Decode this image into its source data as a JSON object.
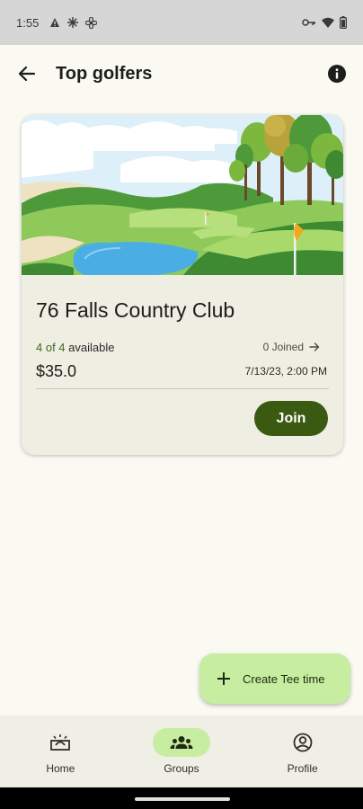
{
  "status_bar": {
    "time": "1:55"
  },
  "app_bar": {
    "title": "Top golfers"
  },
  "card": {
    "course_name": "76 Falls Country Club",
    "availability_count": "4 of 4",
    "availability_suffix": " available",
    "joined_text": "0 Joined",
    "price": "$35.0",
    "datetime": "7/13/23, 2:00 PM",
    "join_label": "Join"
  },
  "fab": {
    "label": "Create Tee time"
  },
  "bottom_nav": {
    "items": [
      {
        "label": "Home",
        "icon": "home-sunrise-icon",
        "active": false
      },
      {
        "label": "Groups",
        "icon": "groups-icon",
        "active": true
      },
      {
        "label": "Profile",
        "icon": "profile-icon",
        "active": false
      }
    ]
  },
  "colors": {
    "background": "#fafaf3",
    "card": "#efeee3",
    "primary_dark": "#3a5a12",
    "accent_light": "#c6eda0",
    "availability_green": "#3d6a1a"
  }
}
